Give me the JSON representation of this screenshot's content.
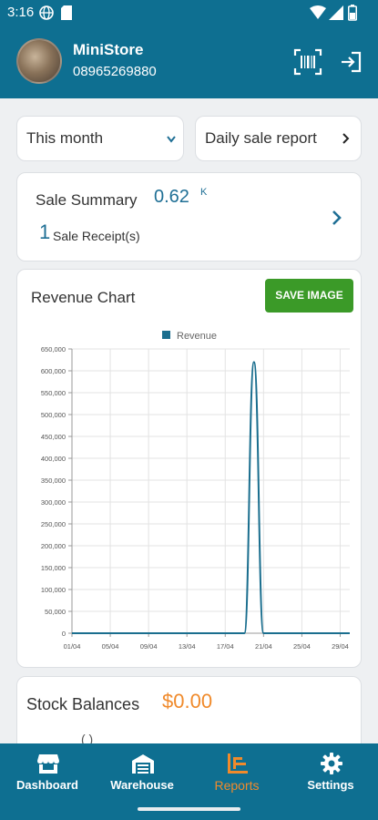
{
  "status": {
    "time": "3:16"
  },
  "header": {
    "store_name": "MiniStore",
    "phone": "08965269880"
  },
  "filters": {
    "period": "This month",
    "report_type": "Daily sale report"
  },
  "summary": {
    "title": "Sale Summary",
    "value": "0.62",
    "unit": "K",
    "receipt_count": "1",
    "receipt_label": "Sale Receipt(s)"
  },
  "chart": {
    "title": "Revenue Chart",
    "save_label": "SAVE IMAGE"
  },
  "chart_data": {
    "type": "line",
    "legend": [
      "Revenue"
    ],
    "x_ticks": [
      "01/04",
      "05/04",
      "09/04",
      "13/04",
      "17/04",
      "21/04",
      "25/04",
      "29/04"
    ],
    "y_ticks": [
      "0",
      "50,000",
      "100,000",
      "150,000",
      "200,000",
      "250,000",
      "300,000",
      "350,000",
      "400,000",
      "450,000",
      "500,000",
      "550,000",
      "600,000",
      "650,000"
    ],
    "ylim": [
      0,
      650000
    ],
    "series": [
      {
        "name": "Revenue",
        "color": "#1a6e8e",
        "points": [
          [
            1,
            0
          ],
          [
            19,
            0
          ],
          [
            20,
            620000
          ],
          [
            21,
            0
          ],
          [
            30,
            0
          ]
        ]
      }
    ],
    "grid": true,
    "legend_position": "top-center"
  },
  "stock": {
    "title": "Stock Balances",
    "value": "$0.00",
    "peek": "(  )"
  },
  "nav": {
    "items": [
      {
        "label": "Dashboard",
        "icon": "store-icon"
      },
      {
        "label": "Warehouse",
        "icon": "warehouse-icon"
      },
      {
        "label": "Reports",
        "icon": "reports-icon",
        "active": true
      },
      {
        "label": "Settings",
        "icon": "gear-icon"
      }
    ]
  },
  "colors": {
    "primary": "#0e6f91",
    "accent": "#f08a2b",
    "value_blue": "#1f6f95",
    "button_green": "#3b9a28"
  }
}
